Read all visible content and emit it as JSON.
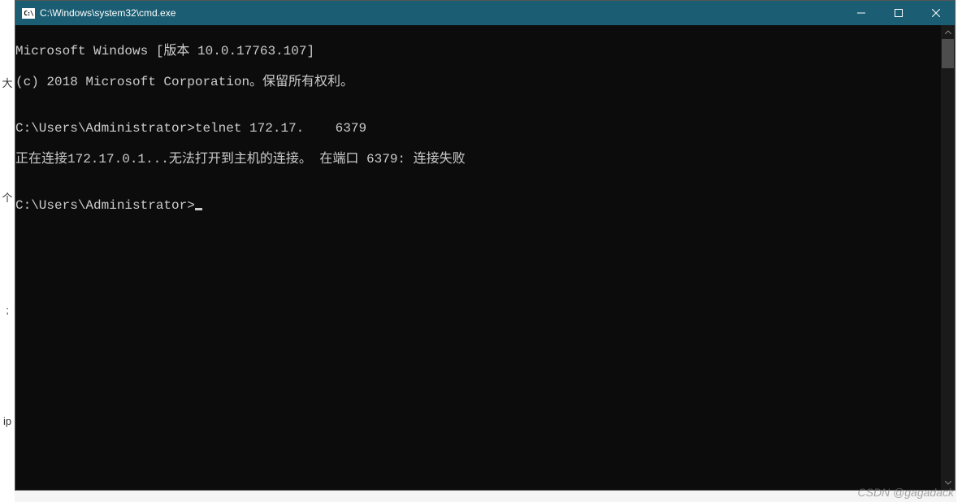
{
  "titlebar": {
    "icon_label": "C:\\",
    "title": "C:\\Windows\\system32\\cmd.exe"
  },
  "console": {
    "line1": "Microsoft Windows [版本 10.0.17763.107]",
    "line2": "(c) 2018 Microsoft Corporation。保留所有权利。",
    "blank1": "",
    "line3_prompt": "C:\\Users\\Administrator>",
    "line3_cmd": "telnet 172.17.    6379",
    "line4": "正在连接172.17.0.1...无法打开到主机的连接。 在端口 6379: 连接失败",
    "blank2": "",
    "line5_prompt": "C:\\Users\\Administrator>"
  },
  "watermark": "CSDN @gagadack",
  "left_fragments": [
    "",
    "大",
    "",
    "个",
    "",
    ";",
    "",
    "ip",
    ""
  ]
}
